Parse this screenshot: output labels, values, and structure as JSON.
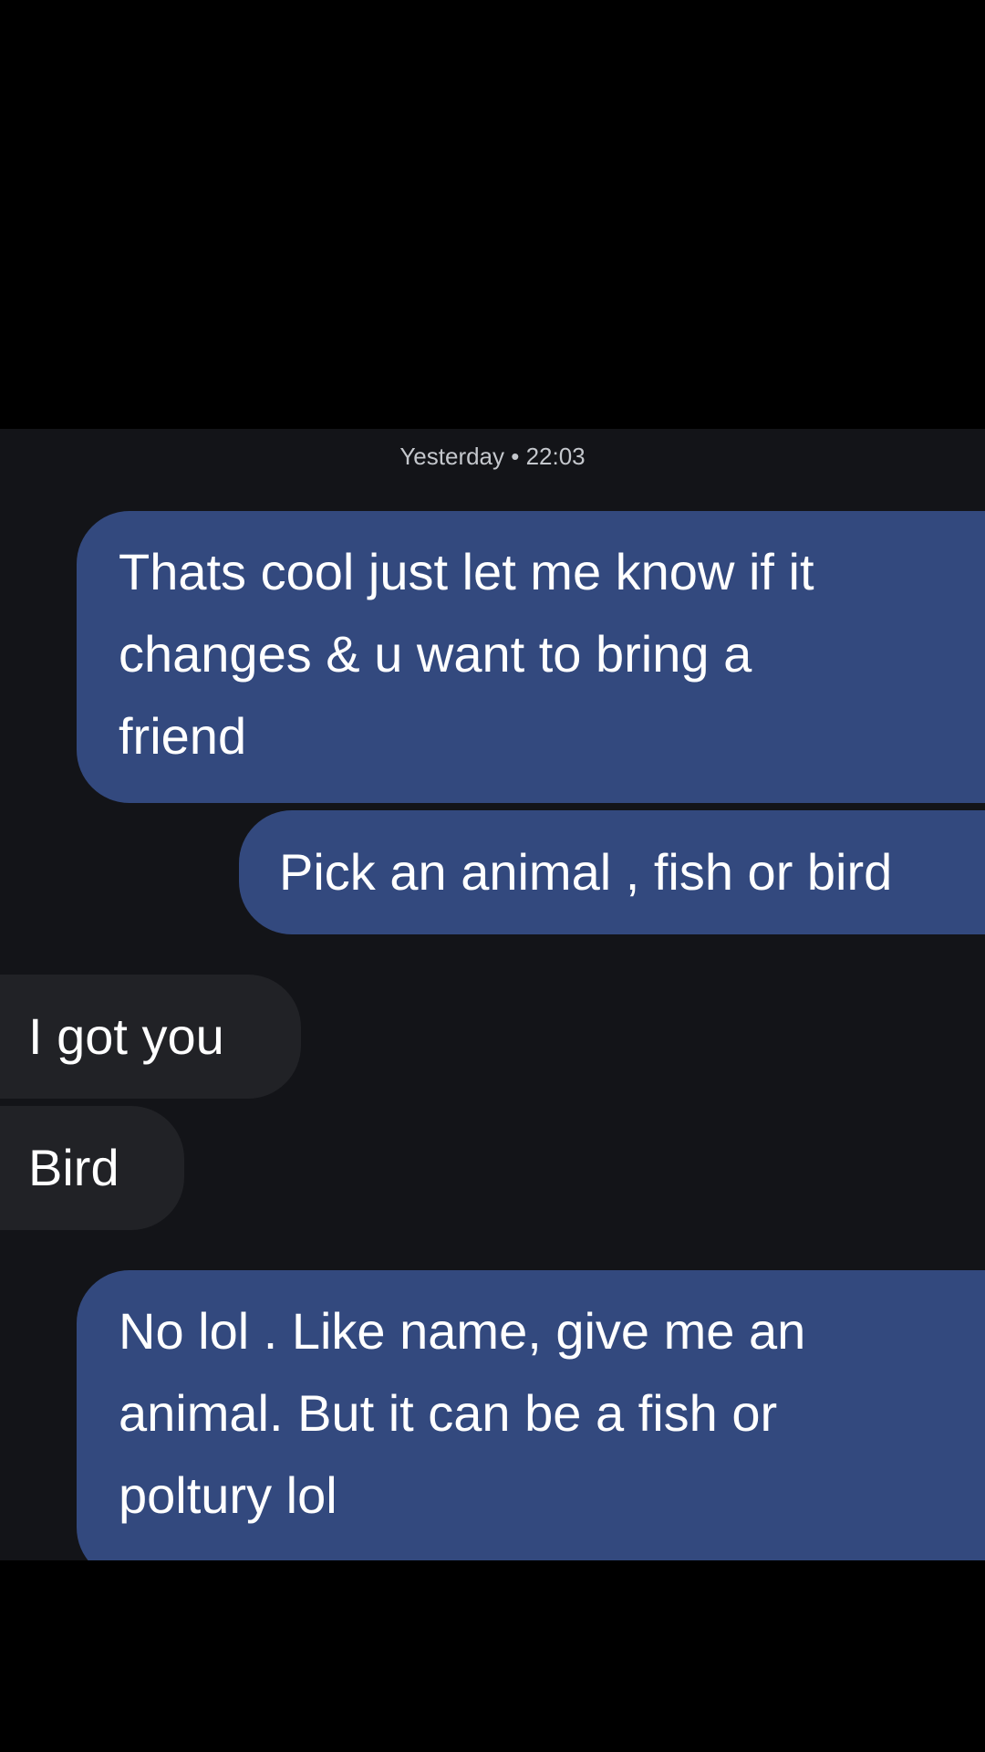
{
  "conversation": {
    "timestamp": "Yesterday • 22:03",
    "messages": [
      {
        "direction": "sent",
        "text": "Thats cool just let me know if it\nchanges & u want to bring a\nfriend"
      },
      {
        "direction": "sent",
        "text": "Pick an animal , fish or bird"
      },
      {
        "direction": "received",
        "text": "I got you"
      },
      {
        "direction": "received",
        "text": "Bird"
      },
      {
        "direction": "sent",
        "text": "No lol . Like name, give me an\nanimal.  But it can be a fish or\npoltury lol"
      }
    ]
  },
  "colors": {
    "background": "#000000",
    "chat_background": "#131418",
    "sent_bubble": "#33497e",
    "received_bubble": "#212226",
    "message_text": "#ffffff",
    "timestamp_text": "#c4c7cc"
  }
}
